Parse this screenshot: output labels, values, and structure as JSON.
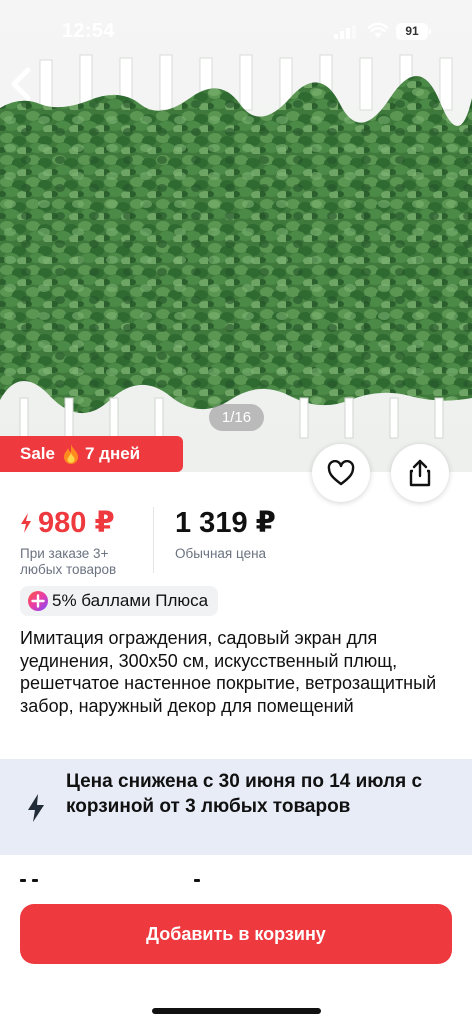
{
  "status_bar": {
    "time": "12:54",
    "battery": "91"
  },
  "gallery": {
    "counter": "1/16"
  },
  "sale_badge": {
    "label": "Sale",
    "days": "7 дней"
  },
  "price": {
    "sale_price": "980 ₽",
    "sale_note": "При заказе 3+ любых товаров",
    "regular_price": "1 319 ₽",
    "regular_note": "Обычная цена"
  },
  "plus_chip": {
    "label": "5% баллами Плюса"
  },
  "product": {
    "title": "Имитация ограждения, садовый экран для уединения, 300x50 см, искусственный плющ, решетчатое настенное покрытие, ветрозащитный забор, наружный декор для помещений"
  },
  "promo": {
    "text": "Цена снижена с 30 июня по 14 июля с корзиной от 3 любых товаров"
  },
  "cart_button": {
    "label": "Добавить в корзину"
  },
  "colors": {
    "accent": "#ee3a3f",
    "promo_bg": "#e7ecf7",
    "chip_bg": "#f1f2f4",
    "muted_text": "#6b7280"
  },
  "icons": [
    "back-icon",
    "heart-icon",
    "share-icon",
    "fire-icon",
    "lightning-icon",
    "plus-points-icon"
  ]
}
